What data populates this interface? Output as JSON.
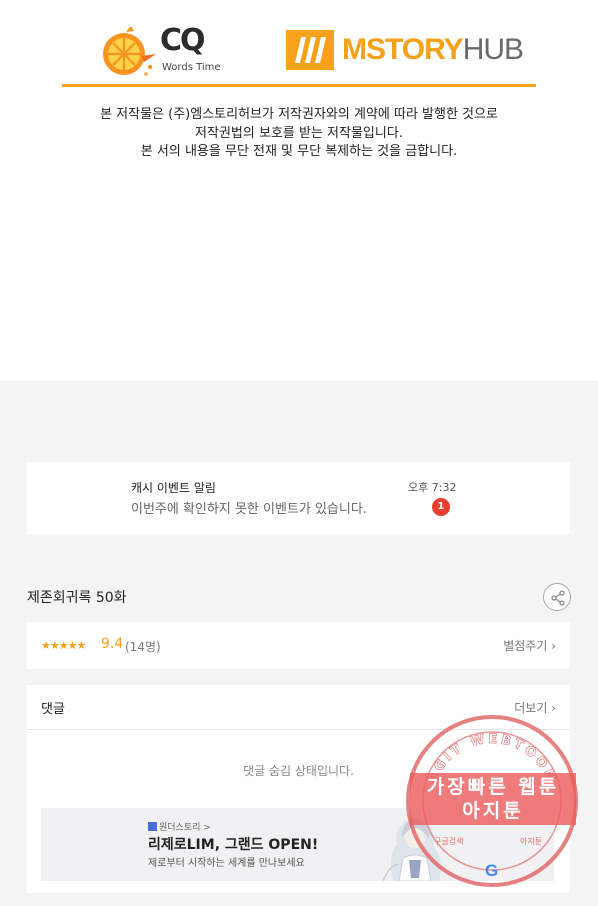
{
  "copyright": {
    "cq_logo": {
      "letters": "CQ",
      "subtitle": "Words Time",
      "icon": "orange-slice-icon"
    },
    "mstory_logo": {
      "text_main": "MSTORY",
      "text_hub": "HUB",
      "icon": "mstory-book-icon"
    },
    "notice_lines": [
      "본 저작물은 (주)엠스토리허브가 저작권자와의 계약에 따라 발행한 것으로",
      "저작권법의 보호를 받는 저작물입니다.",
      "본 서의 내용을 무단 전재 및 무단 복제하는 것을 금합니다."
    ],
    "accent_color": "#f5a11a"
  },
  "notification": {
    "title": "캐시 이벤트 알림",
    "message": "이번주에 확인하지 못한 이벤트가 있습니다.",
    "time": "오후 7:32",
    "badge_count": "1",
    "badge_color": "#e8402e"
  },
  "episode": {
    "title": "제존회귀록 50화",
    "share_icon": "share-icon"
  },
  "rating": {
    "stars": "★★★★★",
    "score": "9.4",
    "votes": "(14명)",
    "rate_link": "별점주기 ›"
  },
  "comments": {
    "title": "댓글",
    "more_link": "더보기 ›",
    "hidden_message": "댓글 숨김 상태입니다.",
    "banner": {
      "brand": "원더스토리 >",
      "title": "리제로LIM, 그랜드 OPEN!",
      "subtitle": "제로부터 시작하는 세계를 만나보세요"
    }
  },
  "watermark": {
    "ring_text": "AGIT WEBTOON",
    "line1": "가장빠른 웹툰",
    "line2": "아지툰",
    "small_left": "구글검색",
    "small_right": "아지툰",
    "google_letter": "G",
    "color": "#e36a6a"
  }
}
